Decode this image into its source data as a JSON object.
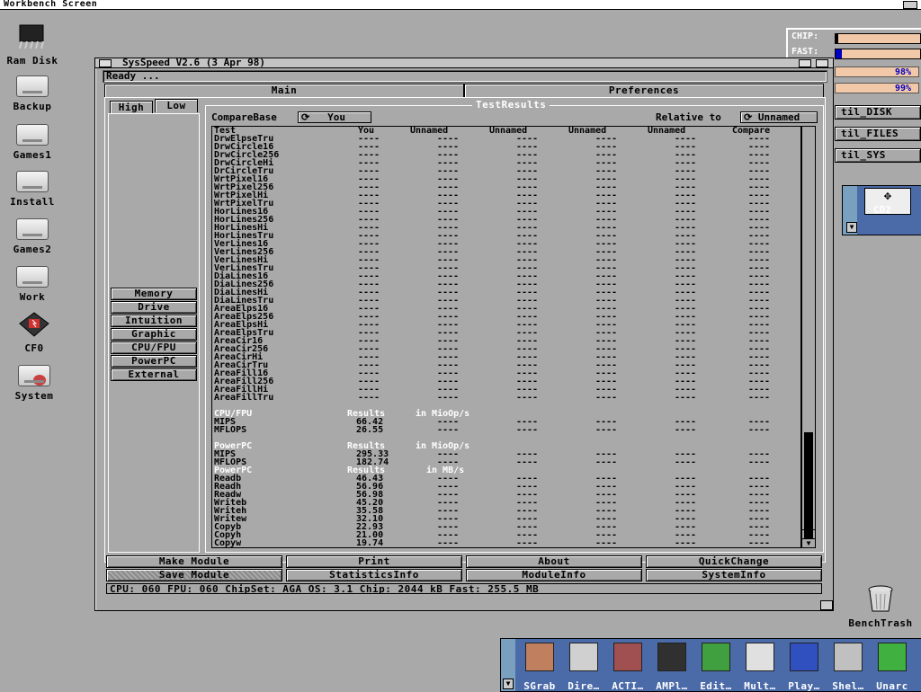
{
  "screen": {
    "title": "Workbench Screen"
  },
  "desktop_icons": [
    {
      "label": "Ram Disk",
      "icon": "chip-icon"
    },
    {
      "label": "Backup",
      "icon": "disk-icon"
    },
    {
      "label": "Games1",
      "icon": "disk-icon"
    },
    {
      "label": "Install",
      "icon": "disk-icon"
    },
    {
      "label": "Games2",
      "icon": "disk-icon"
    },
    {
      "label": "Work",
      "icon": "disk-icon"
    },
    {
      "label": "CF0",
      "icon": "cf-card-icon"
    },
    {
      "label": "System",
      "icon": "disk-icon"
    }
  ],
  "trash": {
    "label": "BenchTrash"
  },
  "monitor": {
    "chip_label": "CHIP:",
    "fast_label": "FAST:",
    "pct1": "98%",
    "pct2": "99%",
    "btn1": "til_DISK",
    "btn2": "til_FILES",
    "btn3": "til_SYS"
  },
  "cd_window": {
    "label": "CD2"
  },
  "window": {
    "title": "SysSpeed  V2.6 (3 Apr 98)",
    "status": "Ready ...",
    "tab_main": "Main",
    "tab_preferences": "Preferences",
    "subtab_high": "High",
    "subtab_low": "Low",
    "side_buttons": [
      "Memory",
      "Drive",
      "Intuition",
      "Graphic",
      "CPU/FPU",
      "PowerPC",
      "External"
    ],
    "results_legend": "TestResults",
    "compare_base_label": "CompareBase",
    "compare_base_value": "You",
    "relative_label": "Relative to",
    "relative_value": "Unnamed",
    "columns": [
      "Test",
      "You",
      "Unnamed",
      "Unnamed",
      "Unnamed",
      "Unnamed",
      "Compare"
    ],
    "buttons": {
      "make_module": "Make Module",
      "print": "Print",
      "about": "About",
      "quickchange": "QuickChange",
      "save_module": "Save Module",
      "statistics": "StatisticsInfo",
      "moduleinfo": "ModuleInfo",
      "systeminfo": "SystemInfo"
    },
    "sysinfo": "CPU: 060  FPU: 060  ChipSet: AGA  OS: 3.1  Chip: 2044 kB  Fast: 255.5 MB"
  },
  "graphics_tests": [
    "DrwElpseTru",
    "DrwCircle16",
    "DrwCircle256",
    "DrwCircleHi",
    "DrCircleTru",
    "WrtPixel16",
    "WrtPixel256",
    "WrtPixelHi",
    "WrtPixelTru",
    "HorLines16",
    "HorLines256",
    "HorLinesHi",
    "HorLinesTru",
    "VerLines16",
    "VerLines256",
    "VerLinesHi",
    "VerLinesTru",
    "DiaLines16",
    "DiaLines256",
    "DiaLinesHi",
    "DiaLinesTru",
    "AreaElps16",
    "AreaElps256",
    "AreaElpsHi",
    "AreaElpsTru",
    "AreaCir16",
    "AreaCir256",
    "AreaCirHi",
    "AreaCirTru",
    "AreaFill16",
    "AreaFill256",
    "AreaFillHi",
    "AreaFillTru"
  ],
  "empty_cell": "----",
  "cpu_section": {
    "name": "CPU/FPU",
    "results": "Results",
    "unit": "in MioOp/s",
    "rows": [
      {
        "test": "MIPS",
        "you": "66.42"
      },
      {
        "test": "MFLOPS",
        "you": "26.55"
      }
    ]
  },
  "ppc_section": {
    "name": "PowerPC",
    "results": "Results",
    "unit": "in MioOp/s",
    "rows": [
      {
        "test": "MIPS",
        "you": "295.33"
      },
      {
        "test": "MFLOPS",
        "you": "182.74"
      }
    ]
  },
  "ppc_mem_section": {
    "name": "PowerPC",
    "results": "Results",
    "unit": "in MB/s",
    "rows": [
      {
        "test": "Readb",
        "you": "46.43"
      },
      {
        "test": "Readh",
        "you": "56.96"
      },
      {
        "test": "Readw",
        "you": "56.98"
      },
      {
        "test": "Writeb",
        "you": "45.20"
      },
      {
        "test": "Writeh",
        "you": "35.58"
      },
      {
        "test": "Writew",
        "you": "32.10"
      },
      {
        "test": "Copyb",
        "you": "22.93"
      },
      {
        "test": "Copyh",
        "you": "21.00"
      },
      {
        "test": "Copyw",
        "you": "19.74"
      }
    ]
  },
  "dock": [
    {
      "label": "SGrab",
      "icon": "camera-grab-icon",
      "color": "#c08060"
    },
    {
      "label": "Dire…",
      "icon": "directory-icon",
      "color": "#d0d0d0"
    },
    {
      "label": "ACTI…",
      "icon": "film-icon",
      "color": "#a05050"
    },
    {
      "label": "AMPl…",
      "icon": "speaker-icon",
      "color": "#303030"
    },
    {
      "label": "Edit…",
      "icon": "pencil-icon",
      "color": "#40a040"
    },
    {
      "label": "Mult…",
      "icon": "magnifier-icon",
      "color": "#e0e0e0"
    },
    {
      "label": "Play…",
      "icon": "disk-play-icon",
      "color": "#3050c0"
    },
    {
      "label": "Shel…",
      "icon": "shell-icon",
      "color": "#c0c0c0"
    },
    {
      "label": "Unarc",
      "icon": "box-icon",
      "color": "#40b040"
    }
  ]
}
